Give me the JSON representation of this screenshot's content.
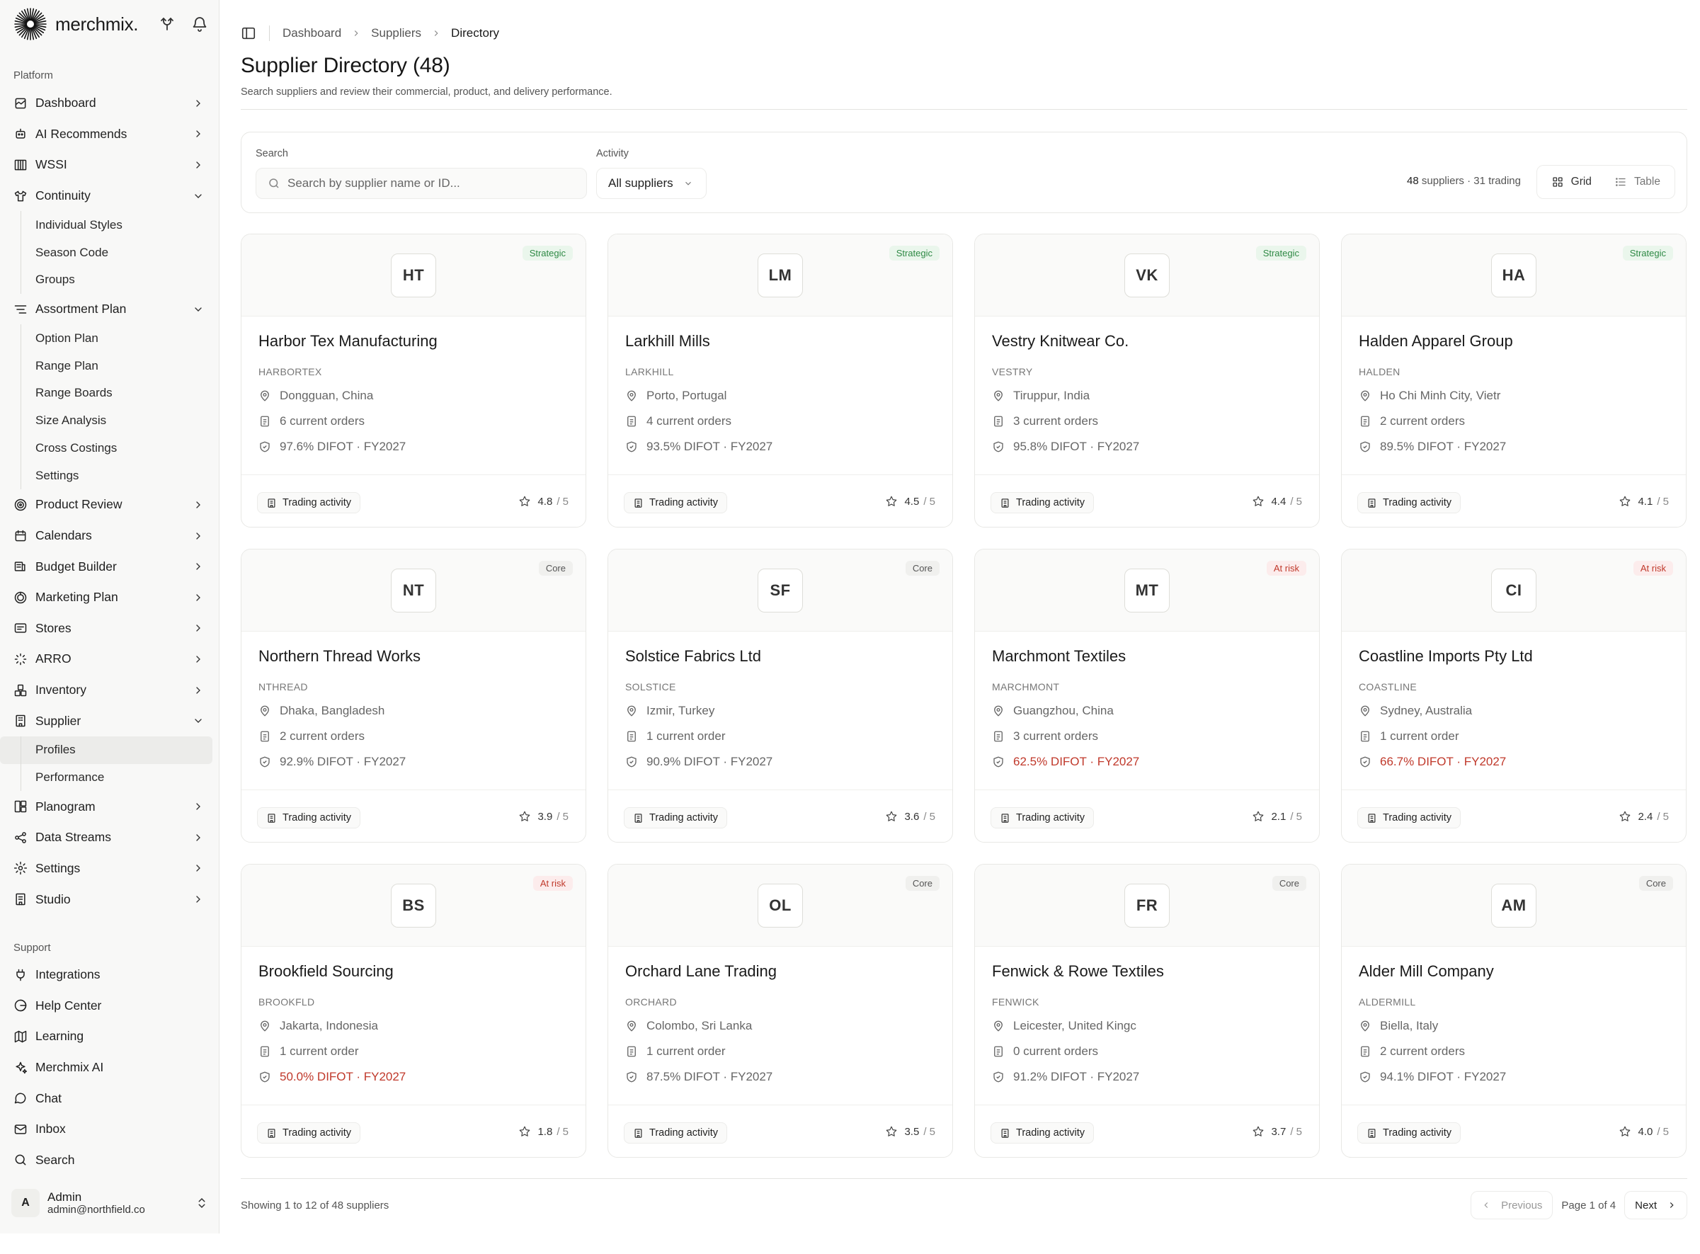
{
  "brand": {
    "name": "merchmix."
  },
  "sidebar": {
    "platform_label": "Platform",
    "items": [
      {
        "label": "Dashboard",
        "icon": "dashboard-icon",
        "expanded": false
      },
      {
        "label": "AI Recommends",
        "icon": "bot-icon",
        "expanded": false
      },
      {
        "label": "WSSI",
        "icon": "columns-icon",
        "expanded": false
      },
      {
        "label": "Continuity",
        "icon": "shirt-icon",
        "expanded": true,
        "children": [
          "Individual Styles",
          "Season Code",
          "Groups"
        ]
      },
      {
        "label": "Assortment Plan",
        "icon": "list-filter-icon",
        "expanded": true,
        "children": [
          "Option Plan",
          "Range Plan",
          "Range Boards",
          "Size Analysis",
          "Cross Costings",
          "Settings"
        ]
      },
      {
        "label": "Product Review",
        "icon": "target-icon",
        "expanded": false
      },
      {
        "label": "Calendars",
        "icon": "calendar-icon",
        "expanded": false
      },
      {
        "label": "Budget Builder",
        "icon": "budget-icon",
        "expanded": false
      },
      {
        "label": "Marketing Plan",
        "icon": "marketing-icon",
        "expanded": false
      },
      {
        "label": "Stores",
        "icon": "store-icon",
        "expanded": false
      },
      {
        "label": "ARRO",
        "icon": "loader-icon",
        "expanded": false
      },
      {
        "label": "Inventory",
        "icon": "boxes-icon",
        "expanded": false
      },
      {
        "label": "Supplier",
        "icon": "building-icon",
        "expanded": true,
        "children": [
          "Profiles",
          "Performance"
        ],
        "active_child": "Profiles"
      },
      {
        "label": "Planogram",
        "icon": "planogram-icon",
        "expanded": false
      },
      {
        "label": "Data Streams",
        "icon": "share-icon",
        "expanded": false
      },
      {
        "label": "Settings",
        "icon": "settings-icon",
        "expanded": false
      },
      {
        "label": "Studio",
        "icon": "studio-icon",
        "expanded": false
      }
    ],
    "support_label": "Support",
    "support_items": [
      {
        "label": "Integrations",
        "icon": "plug-icon"
      },
      {
        "label": "Help Center",
        "icon": "help-icon"
      },
      {
        "label": "Learning",
        "icon": "map-icon"
      },
      {
        "label": "Merchmix AI",
        "icon": "sparkles-icon"
      },
      {
        "label": "Chat",
        "icon": "chat-icon"
      },
      {
        "label": "Inbox",
        "icon": "mail-icon"
      },
      {
        "label": "Search",
        "icon": "search-icon"
      }
    ],
    "user": {
      "initial": "A",
      "name": "Admin",
      "email": "admin@northfield.co"
    }
  },
  "breadcrumb": [
    "Dashboard",
    "Suppliers",
    "Directory"
  ],
  "page": {
    "title": "Supplier Directory (48)",
    "subtitle": "Search suppliers and review their commercial, product, and delivery performance."
  },
  "filters": {
    "search_label": "Search",
    "search_placeholder": "Search by supplier name or ID...",
    "activity_label": "Activity",
    "activity_value": "All suppliers",
    "count_total": "48",
    "count_suffix": "suppliers",
    "count_trading": "· 31 trading",
    "view_grid": "Grid",
    "view_table": "Table"
  },
  "colors": {
    "strategic": "#2f8a45",
    "risk": "#c0392b",
    "accent_bg": "#fafaf9"
  },
  "suppliers": [
    {
      "initials": "HT",
      "tier": "Strategic",
      "tier_class": "strategic",
      "name": "Harbor Tex Manufacturing",
      "code": "HARBORTEX",
      "location": "Dongguan, China",
      "orders": "6 current orders",
      "difot": "97.6% DIFOT · FY2027",
      "risk": false,
      "rating": "4.8"
    },
    {
      "initials": "LM",
      "tier": "Strategic",
      "tier_class": "strategic",
      "name": "Larkhill Mills",
      "code": "LARKHILL",
      "location": "Porto, Portugal",
      "orders": "4 current orders",
      "difot": "93.5% DIFOT · FY2027",
      "risk": false,
      "rating": "4.5"
    },
    {
      "initials": "VK",
      "tier": "Strategic",
      "tier_class": "strategic",
      "name": "Vestry Knitwear Co.",
      "code": "VESTRY",
      "location": "Tiruppur, India",
      "orders": "3 current orders",
      "difot": "95.8% DIFOT · FY2027",
      "risk": false,
      "rating": "4.4"
    },
    {
      "initials": "HA",
      "tier": "Strategic",
      "tier_class": "strategic",
      "name": "Halden Apparel Group",
      "code": "HALDEN",
      "location": "Ho Chi Minh City, Vietr",
      "orders": "2 current orders",
      "difot": "89.5% DIFOT · FY2027",
      "risk": false,
      "rating": "4.1"
    },
    {
      "initials": "NT",
      "tier": "Core",
      "tier_class": "core",
      "name": "Northern Thread Works",
      "code": "NTHREAD",
      "location": "Dhaka, Bangladesh",
      "orders": "2 current orders",
      "difot": "92.9% DIFOT · FY2027",
      "risk": false,
      "rating": "3.9"
    },
    {
      "initials": "SF",
      "tier": "Core",
      "tier_class": "core",
      "name": "Solstice Fabrics Ltd",
      "code": "SOLSTICE",
      "location": "Izmir, Turkey",
      "orders": "1 current order",
      "difot": "90.9% DIFOT · FY2027",
      "risk": false,
      "rating": "3.6"
    },
    {
      "initials": "MT",
      "tier": "At risk",
      "tier_class": "risk",
      "name": "Marchmont Textiles",
      "code": "MARCHMONT",
      "location": "Guangzhou, China",
      "orders": "3 current orders",
      "difot": "62.5% DIFOT · FY2027",
      "risk": true,
      "rating": "2.1"
    },
    {
      "initials": "CI",
      "tier": "At risk",
      "tier_class": "risk",
      "name": "Coastline Imports Pty Ltd",
      "code": "COASTLINE",
      "location": "Sydney, Australia",
      "orders": "1 current order",
      "difot": "66.7% DIFOT · FY2027",
      "risk": true,
      "rating": "2.4"
    },
    {
      "initials": "BS",
      "tier": "At risk",
      "tier_class": "risk",
      "name": "Brookfield Sourcing",
      "code": "BROOKFLD",
      "location": "Jakarta, Indonesia",
      "orders": "1 current order",
      "difot": "50.0% DIFOT · FY2027",
      "risk": true,
      "rating": "1.8"
    },
    {
      "initials": "OL",
      "tier": "Core",
      "tier_class": "core",
      "name": "Orchard Lane Trading",
      "code": "ORCHARD",
      "location": "Colombo, Sri Lanka",
      "orders": "1 current order",
      "difot": "87.5% DIFOT · FY2027",
      "risk": false,
      "rating": "3.5"
    },
    {
      "initials": "FR",
      "tier": "Core",
      "tier_class": "core",
      "name": "Fenwick & Rowe Textiles",
      "code": "FENWICK",
      "location": "Leicester, United Kingc",
      "orders": "0 current orders",
      "difot": "91.2% DIFOT · FY2027",
      "risk": false,
      "rating": "3.7"
    },
    {
      "initials": "AM",
      "tier": "Core",
      "tier_class": "core",
      "name": "Alder Mill Company",
      "code": "ALDERMILL",
      "location": "Biella, Italy",
      "orders": "2 current orders",
      "difot": "94.1% DIFOT · FY2027",
      "risk": false,
      "rating": "4.0"
    }
  ],
  "card_labels": {
    "trading": "Trading activity",
    "rating_max": "/ 5"
  },
  "pagination": {
    "showing": "Showing 1 to 12 of 48 suppliers",
    "previous": "Previous",
    "page_info": "Page 1 of 4",
    "next": "Next"
  }
}
